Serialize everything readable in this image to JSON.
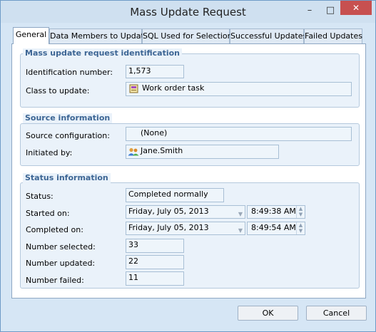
{
  "window": {
    "title": "Mass Update Request",
    "controls": {
      "minimize": "–",
      "maximize": "□",
      "close": "✕"
    }
  },
  "tabs": [
    {
      "label": "General"
    },
    {
      "label": "Data Members to Update"
    },
    {
      "label": "SQL Used for Selection"
    },
    {
      "label": "Successful Updates"
    },
    {
      "label": "Failed Updates"
    }
  ],
  "identification": {
    "title": "Mass update request identification",
    "id_label": "Identification number:",
    "id_value": "1,573",
    "class_label": "Class to update:",
    "class_value": "Work order task",
    "class_icon": "task-icon"
  },
  "source": {
    "title": "Source information",
    "config_label": "Source configuration:",
    "config_value": "(None)",
    "initiated_label": "Initiated by:",
    "initiated_value": "Jane.Smith",
    "user_icon": "users-icon"
  },
  "status": {
    "title": "Status information",
    "status_label": "Status:",
    "status_value": "Completed normally",
    "started_label": "Started on:",
    "started_date": "Friday, July 05, 2013",
    "started_time": "8:49:38 AM",
    "completed_label": "Completed on:",
    "completed_date": "Friday, July 05, 2013",
    "completed_time": "8:49:54 AM",
    "selected_label": "Number selected:",
    "selected_value": "33",
    "updated_label": "Number updated:",
    "updated_value": "22",
    "failed_label": "Number failed:",
    "failed_value": "11"
  },
  "buttons": {
    "ok": "OK",
    "cancel": "Cancel"
  },
  "colors": {
    "accent": "#3c6594",
    "close": "#c75050"
  }
}
